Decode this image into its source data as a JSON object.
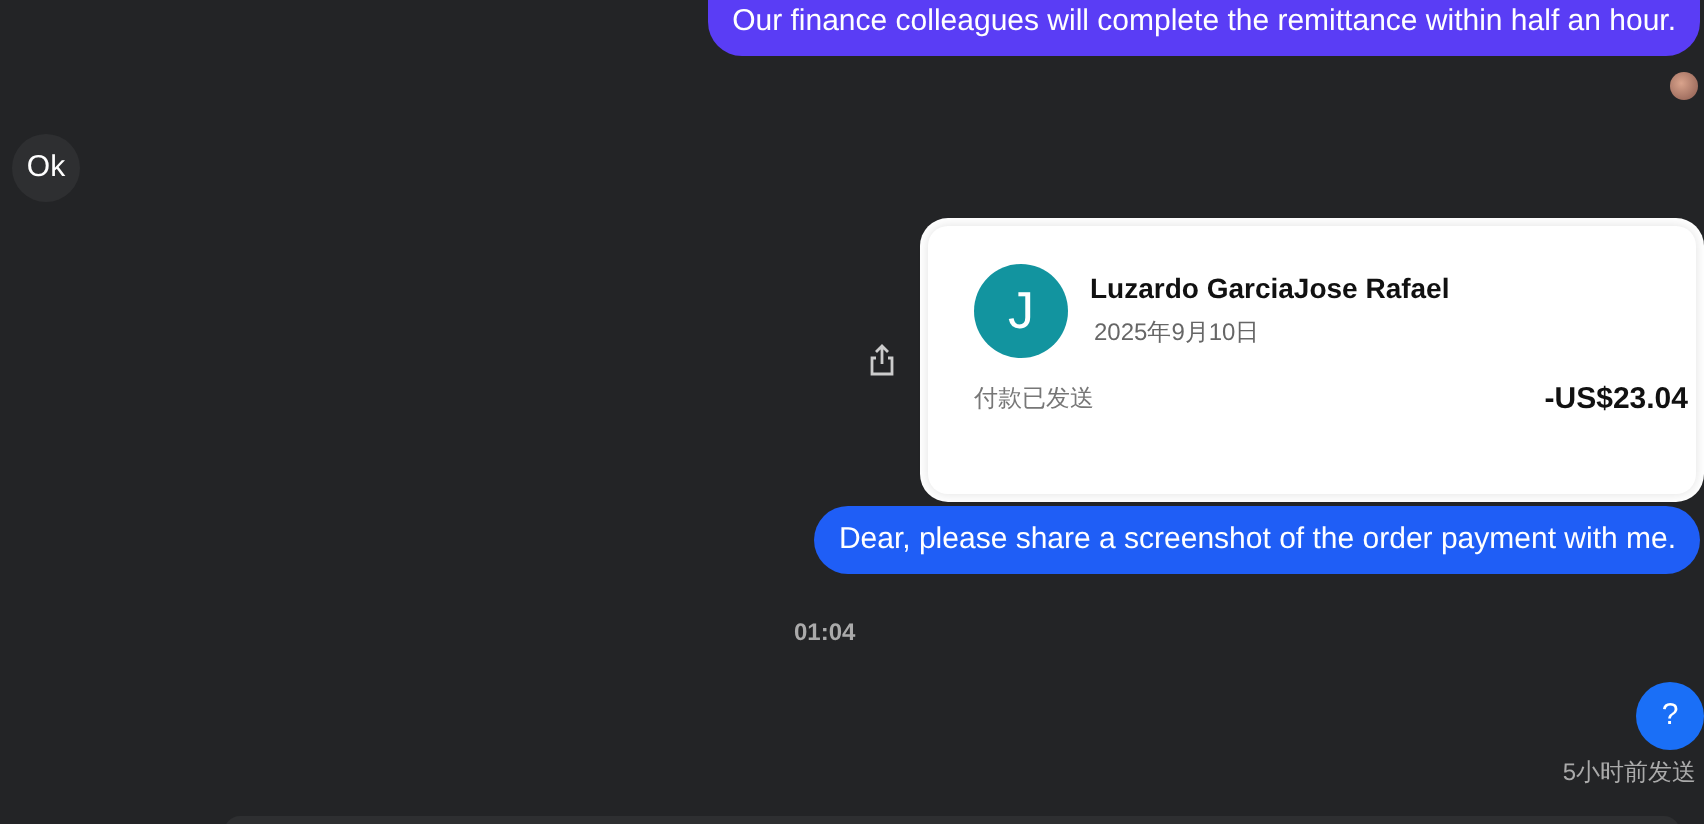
{
  "messages": [
    {
      "kind": "bubble",
      "outgoing": true,
      "text": "Our finance colleagues will complete the remittance within half an hour.",
      "color": "#5a3df5",
      "read": true
    },
    {
      "kind": "bubble",
      "outgoing": false,
      "text": "Ok"
    },
    {
      "kind": "payment",
      "outgoing": true,
      "payment": {
        "initial": "J",
        "name": "Luzardo GarciaJose Rafael",
        "date": "2025年9月10日",
        "status": "付款已发送",
        "amount": "-US$23.04"
      }
    },
    {
      "kind": "bubble",
      "outgoing": true,
      "text": "Dear, please share a screenshot of the order payment with me.",
      "color": "#1f5ef6"
    },
    {
      "kind": "time",
      "text": "01:04"
    },
    {
      "kind": "bubble",
      "outgoing": true,
      "text": "?",
      "color": "#1a6ff7",
      "status": "5小时前发送"
    }
  ]
}
